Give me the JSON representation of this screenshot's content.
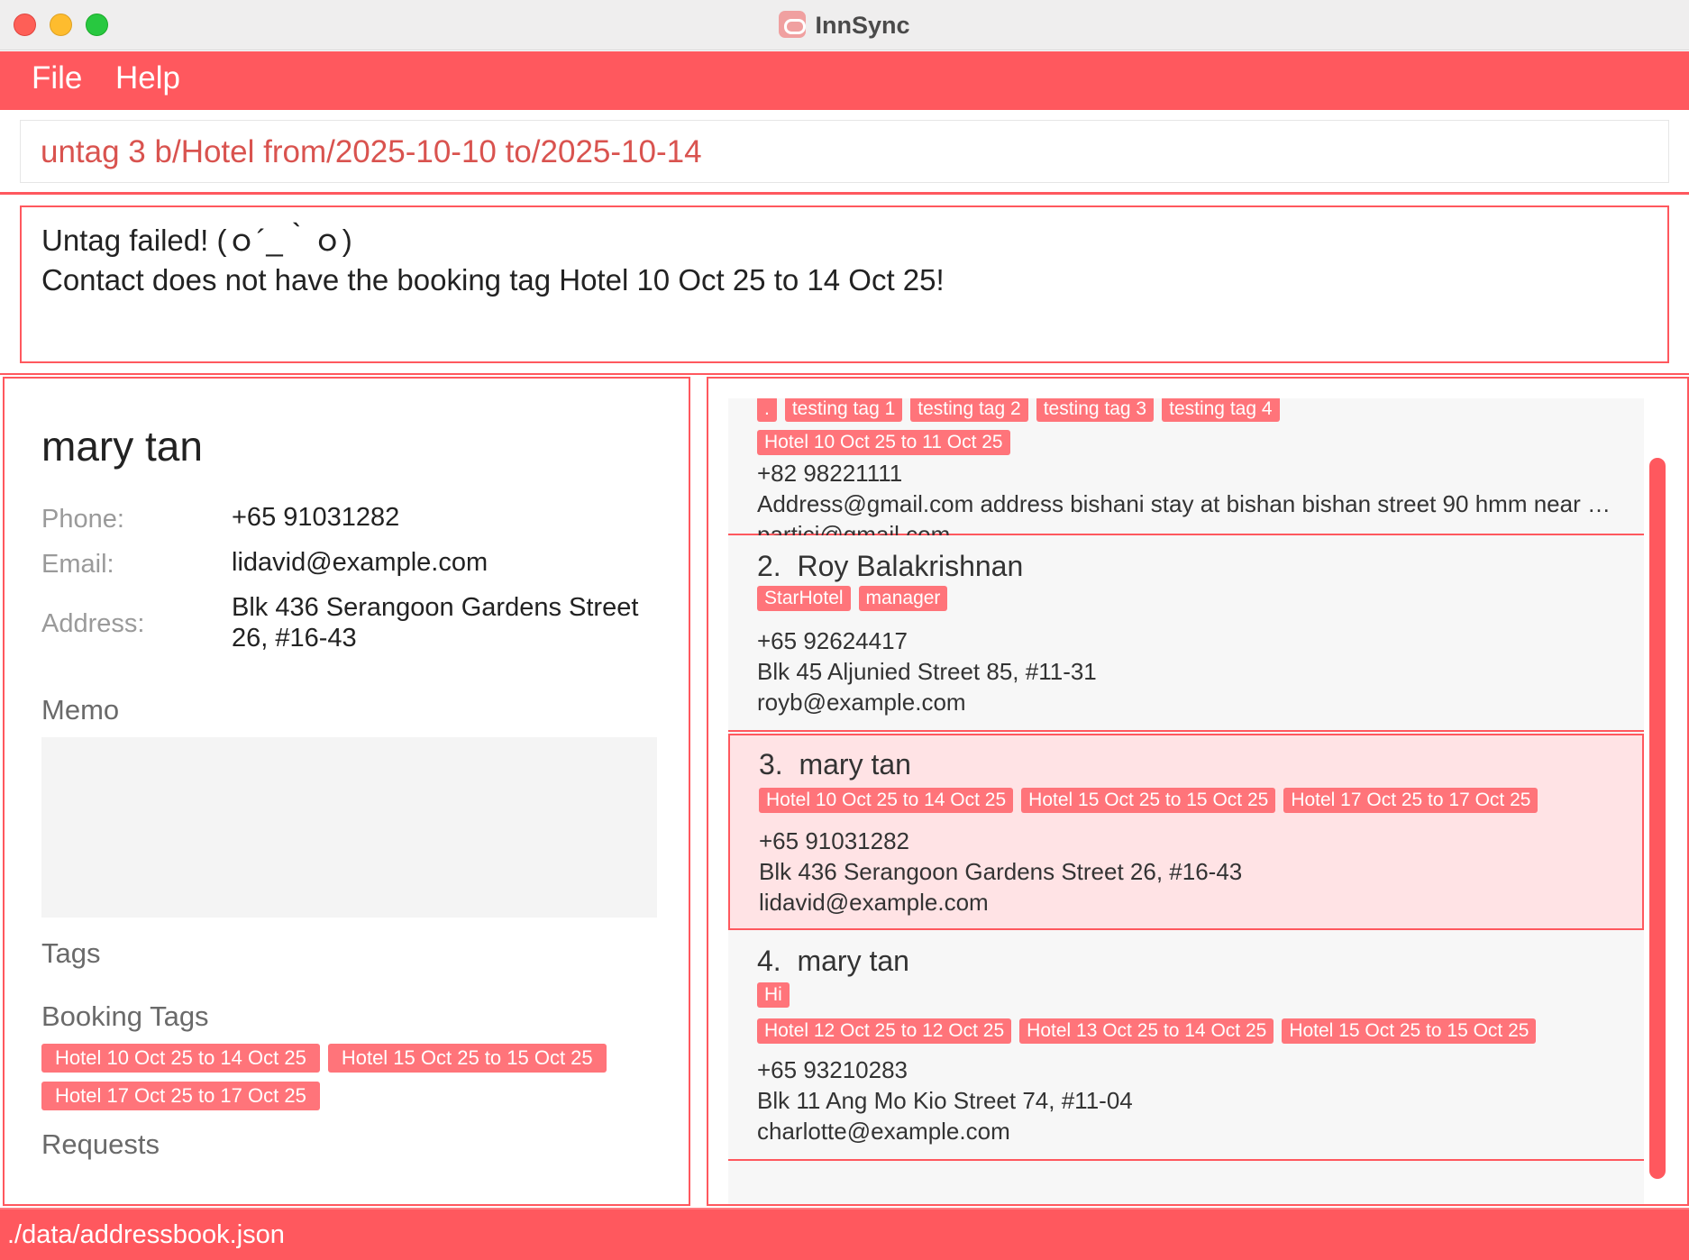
{
  "window": {
    "title": "InnSync",
    "app_icon": "link-icon"
  },
  "menu": {
    "items": [
      "File",
      "Help"
    ]
  },
  "command": {
    "value": "untag 3 b/Hotel from/2025-10-10 to/2025-10-14"
  },
  "result": {
    "line1": "Untag failed! (ｏ´_｀ｏ)",
    "line2": "Contact does not have the booking tag Hotel 10 Oct 25 to 14 Oct 25!"
  },
  "detail": {
    "name": "mary tan",
    "phone_label": "Phone:",
    "phone": "+65 91031282",
    "email_label": "Email:",
    "email": "lidavid@example.com",
    "address_label": "Address:",
    "address_line1": "Blk 436 Serangoon Gardens Street",
    "address_line2": "26, #16-43",
    "memo_heading": "Memo",
    "memo": "",
    "tags_heading": "Tags",
    "booking_heading": "Booking Tags",
    "booking_tags": [
      "Hotel 10 Oct 25 to 14 Oct 25",
      "Hotel 15 Oct 25 to 15 Oct 25",
      "Hotel 17 Oct 25 to 17 Oct 25"
    ],
    "requests_heading": "Requests"
  },
  "list": {
    "card1": {
      "tags": [
        ".",
        "testing tag 1",
        "testing tag 2",
        "testing tag 3",
        "testing tag 4"
      ],
      "booking_tags": [
        "Hotel 10 Oct 25 to 11 Oct 25"
      ],
      "phone": "+82 98221111",
      "address": "Address@gmail.com address bishani stay at bishan bishan street 90 hmm near eunoia j...",
      "email": "partici@gmail.com"
    },
    "card2": {
      "index": "2.",
      "name": "Roy Balakrishnan",
      "tags": [
        "StarHotel",
        "manager"
      ],
      "phone": "+65 92624417",
      "address": "Blk 45 Aljunied Street 85, #11-31",
      "email": "royb@example.com"
    },
    "card3": {
      "index": "3.",
      "name": "mary tan",
      "booking_tags": [
        "Hotel 10 Oct 25 to 14 Oct 25",
        "Hotel 15 Oct 25 to 15 Oct 25",
        "Hotel 17 Oct 25 to 17 Oct 25"
      ],
      "phone": "+65 91031282",
      "address": "Blk 436 Serangoon Gardens Street 26, #16-43",
      "email": "lidavid@example.com"
    },
    "card4": {
      "index": "4.",
      "name": "mary tan",
      "tags": [
        "Hi"
      ],
      "booking_tags": [
        "Hotel 12 Oct 25 to 12 Oct 25",
        "Hotel 13 Oct 25 to 14 Oct 25",
        "Hotel 15 Oct 25 to 15 Oct 25"
      ],
      "phone": "+65 93210283",
      "address": "Blk 11 Ang Mo Kio Street 74, #11-04",
      "email": "charlotte@example.com"
    }
  },
  "status": {
    "path": "./data/addressbook.json"
  },
  "colors": {
    "accent": "#ff585e",
    "tag": "#ff747a",
    "selected_card": "#ffe3e5",
    "command_text": "#d9534f"
  }
}
